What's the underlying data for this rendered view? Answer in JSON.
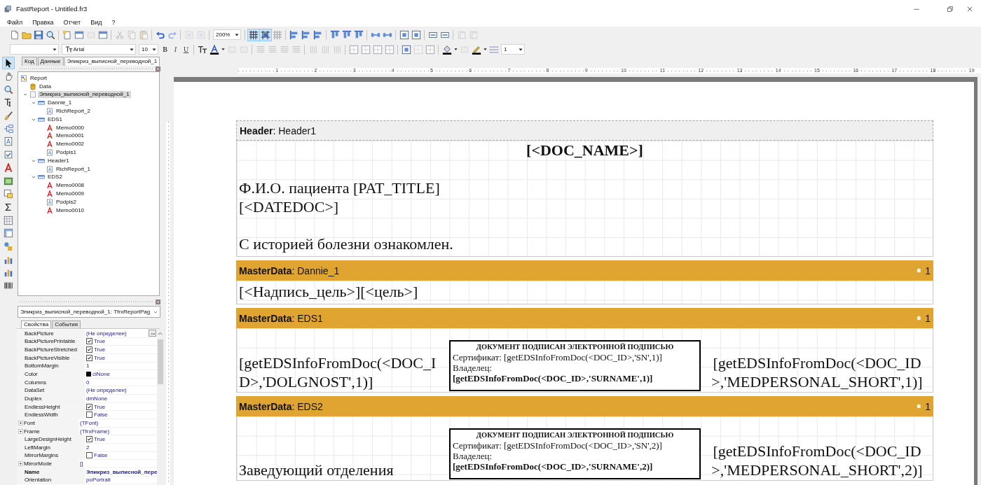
{
  "window": {
    "title": "FastReport - Untitled.fr3"
  },
  "menu": [
    "Файл",
    "Правка",
    "Отчет",
    "Вид",
    "?"
  ],
  "toolbar_standard": [
    {
      "kind": "new",
      "disabled": false
    },
    {
      "kind": "open",
      "disabled": false
    },
    {
      "kind": "save",
      "disabled": false
    },
    {
      "kind": "preview",
      "disabled": false
    },
    {
      "kind": "sep"
    },
    {
      "kind": "new-page",
      "disabled": false
    },
    {
      "kind": "new-dialog",
      "disabled": false
    },
    {
      "kind": "delete-page",
      "disabled": true
    },
    {
      "kind": "page-settings",
      "disabled": false
    },
    {
      "kind": "sep"
    },
    {
      "kind": "cut",
      "disabled": true
    },
    {
      "kind": "copy",
      "disabled": true
    },
    {
      "kind": "paste",
      "disabled": true
    },
    {
      "kind": "sep"
    },
    {
      "kind": "undo",
      "disabled": false
    },
    {
      "kind": "redo",
      "disabled": true
    },
    {
      "kind": "sep"
    },
    {
      "kind": "group",
      "disabled": true
    },
    {
      "kind": "ungroup",
      "disabled": true
    },
    {
      "kind": "sep"
    },
    {
      "kind": "zoom-combo",
      "value": "200%"
    },
    {
      "kind": "sep"
    },
    {
      "kind": "grid",
      "selected": true,
      "disabled": false
    },
    {
      "kind": "snap",
      "selected": true,
      "disabled": false
    },
    {
      "kind": "fit",
      "selected": false,
      "disabled": true
    },
    {
      "kind": "sep"
    },
    {
      "kind": "align-left",
      "disabled": false
    },
    {
      "kind": "align-hcenter",
      "disabled": false
    },
    {
      "kind": "align-right",
      "disabled": false
    },
    {
      "kind": "sep"
    },
    {
      "kind": "align-top",
      "disabled": false
    },
    {
      "kind": "align-vcenter",
      "disabled": false
    },
    {
      "kind": "align-bottom",
      "disabled": false
    },
    {
      "kind": "sep"
    },
    {
      "kind": "space-h",
      "disabled": false
    },
    {
      "kind": "space-v",
      "disabled": false
    },
    {
      "kind": "sep"
    },
    {
      "kind": "center-h",
      "disabled": false
    },
    {
      "kind": "center-v",
      "disabled": false
    },
    {
      "kind": "sep"
    },
    {
      "kind": "same-width",
      "disabled": false
    },
    {
      "kind": "same-height",
      "disabled": false
    },
    {
      "kind": "sep"
    },
    {
      "kind": "export",
      "disabled": true
    },
    {
      "kind": "export",
      "disabled": true
    }
  ],
  "toolbar_text": [
    {
      "kind": "style-combo"
    },
    {
      "kind": "font-combo",
      "value": "Arial"
    },
    {
      "kind": "size-combo",
      "value": "10"
    },
    {
      "kind": "bold",
      "label": "B",
      "disabled": false
    },
    {
      "kind": "italic",
      "label": "I",
      "disabled": false
    },
    {
      "kind": "underline",
      "label": "U",
      "disabled": false
    },
    {
      "kind": "sep"
    },
    {
      "kind": "font-settings",
      "disabled": false
    },
    {
      "kind": "font-color",
      "disabled": false
    },
    {
      "kind": "highlight",
      "disabled": true
    },
    {
      "kind": "rotate",
      "disabled": true
    },
    {
      "kind": "sep"
    },
    {
      "kind": "text-align",
      "disabled": true
    },
    {
      "kind": "text-align",
      "disabled": true
    },
    {
      "kind": "text-align",
      "disabled": true
    },
    {
      "kind": "text-align",
      "disabled": true
    },
    {
      "kind": "sep"
    },
    {
      "kind": "valign",
      "disabled": true
    },
    {
      "kind": "valign",
      "disabled": true
    },
    {
      "kind": "valign",
      "disabled": true
    },
    {
      "kind": "sep"
    },
    {
      "kind": "frame-lines",
      "disabled": false
    },
    {
      "kind": "frame-lines",
      "disabled": false
    },
    {
      "kind": "frame-lines",
      "disabled": false
    },
    {
      "kind": "frame-lines",
      "disabled": false
    },
    {
      "kind": "sep"
    },
    {
      "kind": "frame-all",
      "disabled": false
    },
    {
      "kind": "frame-lines",
      "disabled": true
    },
    {
      "kind": "frame-edit",
      "disabled": false
    },
    {
      "kind": "sep"
    },
    {
      "kind": "fill-color",
      "disabled": false
    },
    {
      "kind": "shadow",
      "disabled": true
    },
    {
      "kind": "line-color",
      "disabled": false
    },
    {
      "kind": "line-style",
      "disabled": false
    },
    {
      "kind": "width-combo",
      "value": "1"
    }
  ],
  "toolbox": [
    {
      "kind": "pointer",
      "selected": true
    },
    {
      "kind": "hand",
      "selected": false
    },
    {
      "kind": "zoom",
      "selected": false
    },
    {
      "kind": "text",
      "selected": false
    },
    {
      "kind": "brush",
      "selected": false
    },
    {
      "kind": "tree",
      "selected": false
    },
    {
      "kind": "rich",
      "selected": false
    },
    {
      "kind": "checkbox",
      "selected": false
    },
    {
      "kind": "memo",
      "selected": false
    },
    {
      "kind": "picture",
      "selected": false
    },
    {
      "kind": "subreport",
      "selected": false
    },
    {
      "kind": "sum",
      "selected": false
    },
    {
      "kind": "table",
      "selected": false
    },
    {
      "kind": "crosstab",
      "selected": false
    },
    {
      "kind": "shape",
      "selected": false
    },
    {
      "kind": "chart",
      "selected": false
    },
    {
      "kind": "diagram",
      "selected": false
    },
    {
      "kind": "barcode",
      "selected": false
    }
  ],
  "page_tabs": [
    {
      "label": "Код",
      "selected": false
    },
    {
      "label": "Данные",
      "selected": false
    },
    {
      "label": "Эпикриз_выписной_переводной_1",
      "selected": true
    }
  ],
  "tree": {
    "label": "Report",
    "kind": "report",
    "selected": false,
    "children": [
      {
        "label": "Data",
        "kind": "data",
        "selected": false
      },
      {
        "label": "Эпикриз_выписной_переводной_1",
        "kind": "page",
        "selected": true,
        "expanded": true,
        "children": [
          {
            "label": "Dannie_1",
            "kind": "band",
            "selected": false,
            "expanded": true,
            "children": [
              {
                "label": "RichReport_2",
                "kind": "rich",
                "selected": false
              }
            ]
          },
          {
            "label": "EDS1",
            "kind": "band",
            "selected": false,
            "expanded": true,
            "children": [
              {
                "label": "Memo0000",
                "kind": "memo",
                "selected": false
              },
              {
                "label": "Memo0001",
                "kind": "memo",
                "selected": false
              },
              {
                "label": "Memo0002",
                "kind": "memo",
                "selected": false
              },
              {
                "label": "Podpis1",
                "kind": "rich",
                "selected": false
              }
            ]
          },
          {
            "label": "Header1",
            "kind": "band",
            "selected": false,
            "expanded": true,
            "children": [
              {
                "label": "RichReport_1",
                "kind": "rich",
                "selected": false
              }
            ]
          },
          {
            "label": "EDS2",
            "kind": "band",
            "selected": false,
            "expanded": true,
            "children": [
              {
                "label": "Memo0008",
                "kind": "memo",
                "selected": false
              },
              {
                "label": "Memo0009",
                "kind": "memo",
                "selected": false
              },
              {
                "label": "Podpis2",
                "kind": "rich",
                "selected": false
              },
              {
                "label": "Memo0010",
                "kind": "memo",
                "selected": false
              }
            ]
          }
        ]
      }
    ]
  },
  "inspector": {
    "object": "Эпикриз_выписной_переводной_1: TfrxReportPag",
    "tabs": [
      {
        "label": "Свойства",
        "selected": true
      },
      {
        "label": "События",
        "selected": false
      }
    ],
    "properties": [
      {
        "name": "BackPicture",
        "value": "(Не определен)",
        "kind": "picker"
      },
      {
        "name": "BackPicturePrintable",
        "value": "True",
        "kind": "bool",
        "checked": true
      },
      {
        "name": "BackPictureStretched",
        "value": "True",
        "kind": "bool",
        "checked": true
      },
      {
        "name": "BackPictureVisible",
        "value": "True",
        "kind": "bool",
        "checked": true
      },
      {
        "name": "BottomMargin",
        "value": "1",
        "kind": "text"
      },
      {
        "name": "Color",
        "value": "clNone",
        "kind": "color",
        "color": "#000000"
      },
      {
        "name": "Columns",
        "value": "0",
        "kind": "text"
      },
      {
        "name": "DataSet",
        "value": "(Не определен)",
        "kind": "text"
      },
      {
        "name": "Duplex",
        "value": "dmNone",
        "kind": "text"
      },
      {
        "name": "EndlessHeight",
        "value": "True",
        "kind": "bool",
        "checked": true
      },
      {
        "name": "EndlessWidth",
        "value": "False",
        "kind": "bool",
        "checked": false
      },
      {
        "name": "Font",
        "value": "(TFont)",
        "kind": "group"
      },
      {
        "name": "Frame",
        "value": "(TfrxFrame)",
        "kind": "group"
      },
      {
        "name": "LargeDesignHeight",
        "value": "True",
        "kind": "bool",
        "checked": true
      },
      {
        "name": "LeftMargin",
        "value": "2",
        "kind": "text"
      },
      {
        "name": "MirrorMargins",
        "value": "False",
        "kind": "bool",
        "checked": false
      },
      {
        "name": "MirrorMode",
        "value": "[]",
        "kind": "group"
      },
      {
        "name": "Name",
        "value": "Эпикриз_выписной_пере",
        "kind": "name"
      },
      {
        "name": "Orientation",
        "value": "poPortrait",
        "kind": "text"
      }
    ]
  },
  "ruler": {
    "labels": [
      "1",
      "2",
      "3",
      "4",
      "5",
      "6",
      "7",
      "8",
      "9",
      "10",
      "11",
      "12",
      "13",
      "14",
      "15",
      "16",
      "17",
      "18",
      "19"
    ]
  },
  "bands": [
    {
      "kind": "header",
      "title": "**Header**: Header1",
      "items": [
        {
          "kind": "title",
          "text": "[<DOC_NAME>]"
        },
        {
          "kind": "text",
          "text": "Ф.И.О. пациента [PAT_TITLE]"
        },
        {
          "kind": "text",
          "text": "[<DATEDOC>]"
        },
        {
          "kind": "text",
          "text": "С историей болезни ознакомлен."
        }
      ]
    },
    {
      "kind": "masterdata",
      "title": "**MasterData**: Dannie_1",
      "number": "1",
      "items": [
        {
          "kind": "text",
          "text": "[<Надпись_цель>][<цель>]"
        }
      ]
    },
    {
      "kind": "masterdata",
      "title": "**MasterData**: EDS1",
      "number": "1",
      "items": [
        {
          "kind": "left",
          "text": "[getEDSInfoFromDoc(<DOC_ID>,'DOLGNOST',1)]"
        },
        {
          "kind": "stamp",
          "heading": "ДОКУМЕНТ ПОДПИСАН ЭЛЕКТРОННОЙ ПОДПИСЬЮ",
          "certificate": "Сертификат: [getEDSInfoFromDoc(<DOC_ID>,'SN',1)]",
          "owner_label": "Владелец:",
          "owner": "[getEDSInfoFromDoc(<DOC_ID>,'SURNAME',1)]"
        },
        {
          "kind": "right",
          "text": "[getEDSInfoFromDoc(<DOC_ID>,'MEDPERSONAL_SHORT',1)]"
        }
      ]
    },
    {
      "kind": "masterdata",
      "title": "**MasterData**: EDS2",
      "number": "1",
      "items": [
        {
          "kind": "left",
          "text": "Заведующий отделения"
        },
        {
          "kind": "stamp",
          "heading": "ДОКУМЕНТ ПОДПИСАН ЭЛЕКТРОННОЙ ПОДПИСЬЮ",
          "certificate": "Сертификат: [getEDSInfoFromDoc(<DOC_ID>,'SN',2)]",
          "owner_label": "Владелец:",
          "owner": "[getEDSInfoFromDoc(<DOC_ID>,'SURNAME',2)]"
        },
        {
          "kind": "right",
          "text": "[getEDSInfoFromDoc(<DOC_ID>,'MEDPERSONAL_SHORT',2)]"
        }
      ]
    }
  ]
}
